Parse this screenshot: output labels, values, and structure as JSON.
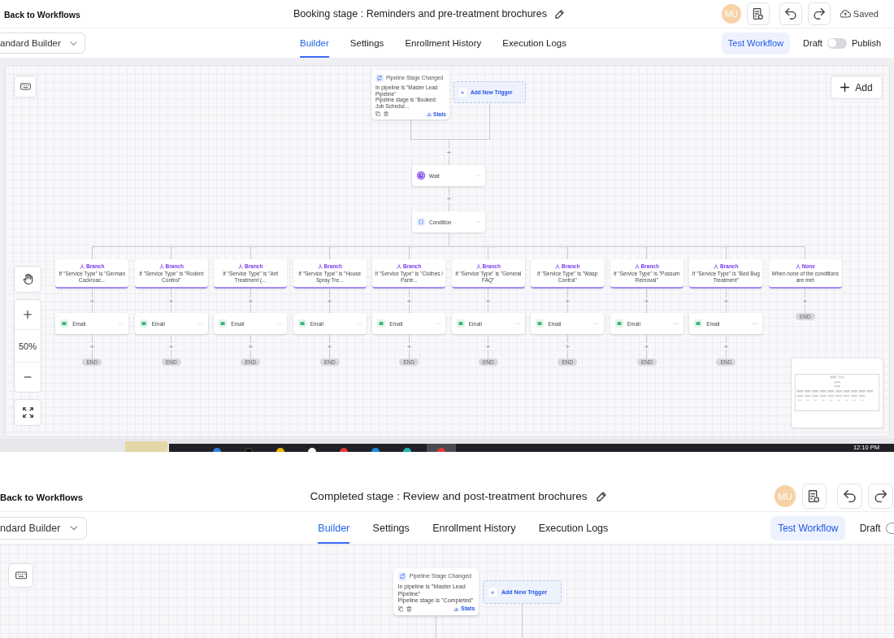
{
  "editors": [
    {
      "back_link": "Back to Workflows",
      "title": "Booking stage : Reminders and pre-treatment brochures",
      "avatar": "MU",
      "save_status": "Saved",
      "builder_select": "andard Builder",
      "tabs": [
        {
          "label": "Builder",
          "selected": true
        },
        {
          "label": "Settings",
          "selected": false
        },
        {
          "label": "Enrollment History",
          "selected": false
        },
        {
          "label": "Execution Logs",
          "selected": false
        }
      ],
      "test_button": "Test Workflow",
      "draft_label": "Draft",
      "publish_toggle": {
        "on": false
      },
      "publish_label": "Publish",
      "canvas": {
        "add_button": "Add",
        "zoom_level": "50%",
        "trigger": {
          "title": "Pipeline Stage Changed",
          "lines": [
            "In pipeline is \"Master Lead Pipeline\"",
            "Pipeline stage is \"Booked: Job Schedul..."
          ],
          "stats": "Stats"
        },
        "add_trigger": "Add New Trigger",
        "steps": [
          {
            "kind": "wait",
            "label": "Wait"
          },
          {
            "kind": "condition",
            "label": "Condition"
          }
        ],
        "branches": [
          {
            "title": "Branch",
            "condition": "If \"Service Type\" is \"German Cockroac...",
            "children": [
              {
                "kind": "email",
                "label": "Email"
              }
            ],
            "end": "END"
          },
          {
            "title": "Branch",
            "condition": "If \"Service Type\" is \"Rodent Control\"",
            "children": [
              {
                "kind": "email",
                "label": "Email"
              }
            ],
            "end": "END"
          },
          {
            "title": "Branch",
            "condition": "If \"Service Type\" is \"Ant Treatment (...",
            "children": [
              {
                "kind": "email",
                "label": "Email"
              }
            ],
            "end": "END"
          },
          {
            "title": "Branch",
            "condition": "If \"Service Type\" is \"House Spray Tre...",
            "children": [
              {
                "kind": "email",
                "label": "Email"
              }
            ],
            "end": "END"
          },
          {
            "title": "Branch",
            "condition": "If \"Service Type\" is \"Clothes / Pantr...",
            "children": [
              {
                "kind": "email",
                "label": "Email"
              }
            ],
            "end": "END"
          },
          {
            "title": "Branch",
            "condition": "If \"Service Type\" is \"General FAQ\"",
            "children": [
              {
                "kind": "email",
                "label": "Email"
              }
            ],
            "end": "END"
          },
          {
            "title": "Branch",
            "condition": "If \"Service Type\" is \"Wasp Control\"",
            "children": [
              {
                "kind": "email",
                "label": "Email"
              }
            ],
            "end": "END"
          },
          {
            "title": "Branch",
            "condition": "If \"Service Type\" is \"Possum Removal\"",
            "children": [
              {
                "kind": "email",
                "label": "Email"
              }
            ],
            "end": "END"
          },
          {
            "title": "Branch",
            "condition": "If \"Service Type\" is \"Bed Bug Treatment\"",
            "children": [
              {
                "kind": "email",
                "label": "Email"
              }
            ],
            "end": "END"
          },
          {
            "title": "None",
            "condition": "When none of the conditions are met",
            "end": "END"
          }
        ]
      }
    },
    {
      "back_link": "Back to Workflows",
      "title": "Completed stage : Review and post-treatment brochures",
      "avatar": "MU",
      "builder_select": "ndard Builder",
      "tabs": [
        {
          "label": "Builder",
          "selected": true
        },
        {
          "label": "Settings",
          "selected": false
        },
        {
          "label": "Enrollment History",
          "selected": false
        },
        {
          "label": "Execution Logs",
          "selected": false
        }
      ],
      "test_button": "Test Workflow",
      "draft_label": "Draft",
      "publish_toggle": {
        "on": false
      },
      "canvas": {
        "trigger": {
          "title": "Pipeline Stage Changed",
          "lines": [
            "In pipeline is \"Master Lead Pipeline\"",
            "Pipeline stage is \"Completed\""
          ],
          "stats": "Stats"
        },
        "add_trigger": "Add New Trigger"
      }
    }
  ],
  "taskbar": {
    "clock": "12:10 PM"
  }
}
